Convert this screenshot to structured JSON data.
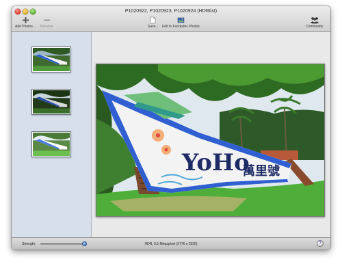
{
  "window": {
    "title": "P1020922, P1020923, P1020924 (HDRtist)"
  },
  "toolbar": {
    "add_photos_label": "Add Photos...",
    "remove_label": "Remove",
    "save_label": "Save...",
    "edit_label": "Edit In Fundadoc Photos",
    "community_label": "Community"
  },
  "sidebar": {
    "thumbnails": [
      "exposure-dark",
      "exposure-mid",
      "exposure-light"
    ]
  },
  "bottombar": {
    "strength_label": "Strength:",
    "strength_value": 1.0,
    "status": "HDR, 9.5 Megapixel (3776 x 2520)",
    "help_label": "?"
  },
  "colors": {
    "sidebar_bg": "#d6dfea",
    "accent_blue": "#3b6fc5",
    "boat_blue": "#2f5fd0"
  },
  "icons": [
    "plus-icon",
    "minus-icon",
    "save-icon",
    "photos-icon",
    "community-icon",
    "help-icon"
  ],
  "photo": {
    "boat_text": "YoHo",
    "boat_chinese": "萬里號"
  }
}
